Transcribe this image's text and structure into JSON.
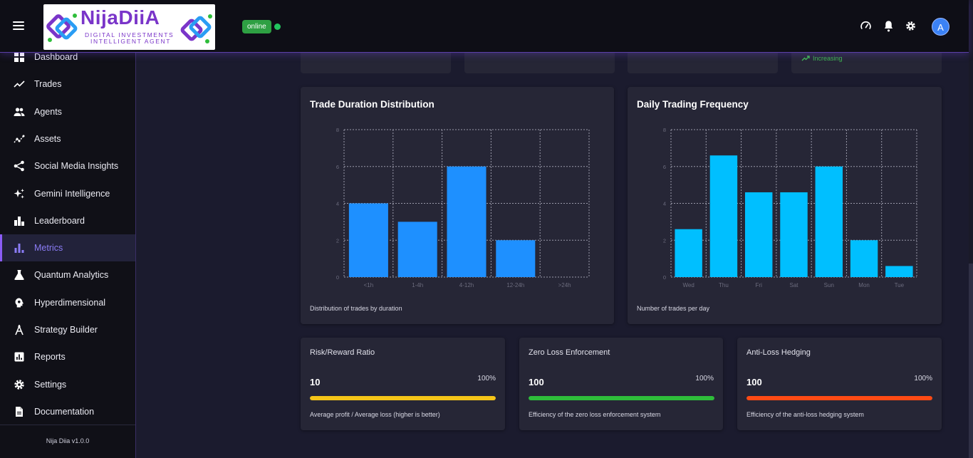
{
  "app": {
    "logo_name": "NijaDiiA",
    "logo_sub1": "DIGITAL INVESTMENTS",
    "logo_sub2": "INTELLIGENT AGENT",
    "status": "online",
    "avatar_letter": "A",
    "version": "Nija Diia v1.0.0"
  },
  "sidebar": {
    "items": [
      {
        "label": "Dashboard",
        "icon": "dashboard-icon"
      },
      {
        "label": "Trades",
        "icon": "trending-icon"
      },
      {
        "label": "Agents",
        "icon": "people-icon"
      },
      {
        "label": "Assets",
        "icon": "scatter-trend-icon"
      },
      {
        "label": "Social Media Insights",
        "icon": "share-icon"
      },
      {
        "label": "Gemini Intelligence",
        "icon": "sparkle-icon"
      },
      {
        "label": "Leaderboard",
        "icon": "leaderboard-icon"
      },
      {
        "label": "Metrics",
        "icon": "bar-chart-icon",
        "active": true
      },
      {
        "label": "Quantum Analytics",
        "icon": "flask-icon"
      },
      {
        "label": "Hyperdimensional",
        "icon": "brain-icon"
      },
      {
        "label": "Strategy Builder",
        "icon": "compass-icon"
      },
      {
        "label": "Reports",
        "icon": "report-icon"
      },
      {
        "label": "Settings",
        "icon": "gear-icon"
      },
      {
        "label": "Documentation",
        "icon": "document-icon"
      }
    ]
  },
  "stat_cards": {
    "trend_label": "Increasing"
  },
  "charts": {
    "duration": {
      "caption": "Distribution of trades by duration"
    },
    "frequency": {
      "caption": "Number of trades per day"
    }
  },
  "chart_data": [
    {
      "type": "bar",
      "title": "Trade Duration Distribution",
      "categories": [
        "<1h",
        "1-4h",
        "4-12h",
        "12-24h",
        ">24h"
      ],
      "values": [
        4,
        3,
        6,
        2,
        0
      ],
      "ylim": [
        0,
        8
      ],
      "yticks": [
        0,
        2,
        4,
        6,
        8
      ],
      "grid": true,
      "color": "#1e90ff"
    },
    {
      "type": "bar",
      "title": "Daily Trading Frequency",
      "categories": [
        "Wed",
        "Thu",
        "Fri",
        "Sat",
        "Sun",
        "Mon",
        "Tue"
      ],
      "values": [
        2.6,
        6.6,
        4.6,
        4.6,
        6,
        2,
        0.6
      ],
      "ylim": [
        0,
        8
      ],
      "yticks": [
        0,
        2,
        4,
        6,
        8
      ],
      "grid": true,
      "color": "#00bfff"
    }
  ],
  "metrics": [
    {
      "title": "Risk/Reward Ratio",
      "value": "10",
      "percent_label": "100%",
      "progress": 100,
      "color": "#f5c518",
      "description": "Average profit / Average loss (higher is better)"
    },
    {
      "title": "Zero Loss Enforcement",
      "value": "100",
      "percent_label": "100%",
      "progress": 100,
      "color": "#2ebd3a",
      "description": "Efficiency of the zero loss enforcement system"
    },
    {
      "title": "Anti-Loss Hedging",
      "value": "100",
      "percent_label": "100%",
      "progress": 100,
      "color": "#ff4a14",
      "description": "Efficiency of the anti-loss hedging system"
    }
  ]
}
